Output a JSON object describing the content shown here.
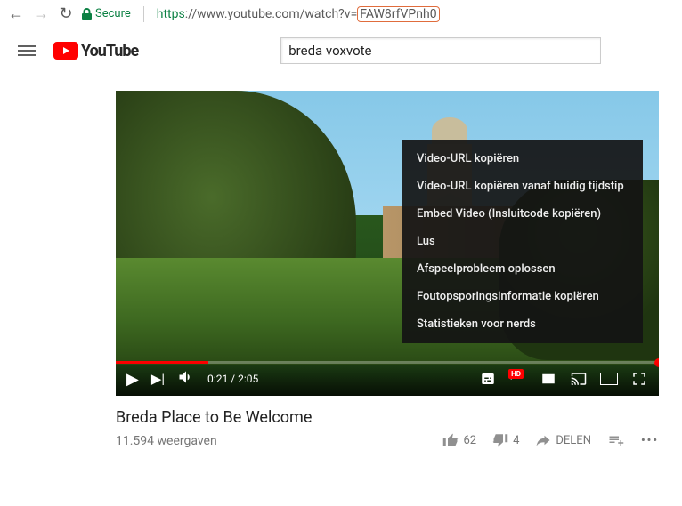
{
  "browser": {
    "secure_label": "Secure",
    "protocol": "https",
    "url_prefix": "://www.youtube.com/watch?v=",
    "video_id": "FAW8rfVPnh0"
  },
  "header": {
    "logo_text": "YouTube",
    "search_value": "breda voxvote"
  },
  "player": {
    "current_time": "0:21",
    "duration": "2:05",
    "time_sep": " / "
  },
  "context_menu": {
    "items": [
      "Video-URL kopiëren",
      "Video-URL kopiëren vanaf huidig tijdstip",
      "Embed Video (Insluitcode kopiëren)",
      "Lus",
      "Afspeelprobleem oplossen",
      "Foutopsporingsinformatie kopiëren",
      "Statistieken voor nerds"
    ]
  },
  "video": {
    "title": "Breda Place to Be Welcome",
    "views": "11.594 weergaven",
    "likes": "62",
    "dislikes": "4",
    "share_label": "DELEN"
  },
  "quality_badge": "HD"
}
